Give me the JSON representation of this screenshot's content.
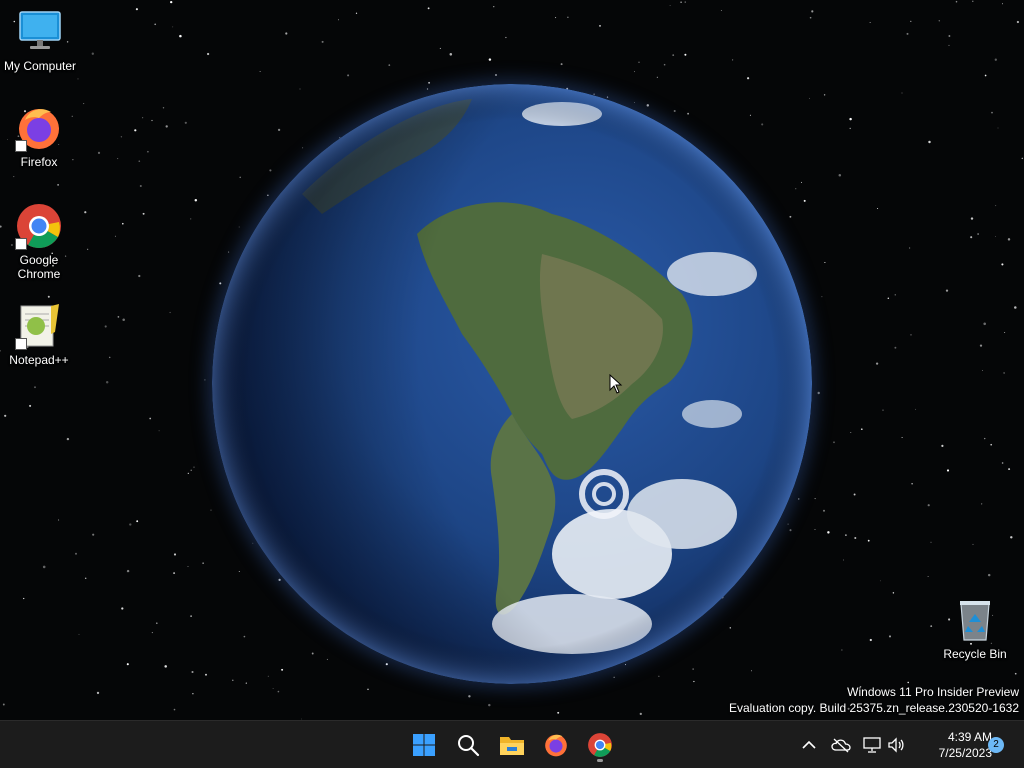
{
  "desktop": {
    "icons": [
      {
        "label": "My Computer"
      },
      {
        "label": "Firefox"
      },
      {
        "label": "Google Chrome"
      },
      {
        "label": "Notepad++"
      },
      {
        "label": "Recycle Bin"
      }
    ],
    "watermark": {
      "line1": "Windows 11 Pro Insider Preview",
      "line2": "Evaluation copy. Build 25375.zn_release.230520-1632"
    }
  },
  "taskbar": {
    "pinned": [
      {
        "name": "start-icon"
      },
      {
        "name": "search-icon"
      },
      {
        "name": "file-explorer-icon"
      },
      {
        "name": "firefox-icon"
      },
      {
        "name": "chrome-icon",
        "active": true
      }
    ],
    "tray": {
      "icons": [
        "chevron-up-icon",
        "onedrive-icon",
        "network-icon",
        "volume-icon"
      ],
      "time": "4:39 AM",
      "date": "7/25/2023",
      "notification_count": "2"
    }
  },
  "colors": {
    "taskbar_bg": "#1c1c1c",
    "desktop_bg": "#050607",
    "ocean": "#1e4c8f",
    "badge": "#6cb8f6"
  }
}
